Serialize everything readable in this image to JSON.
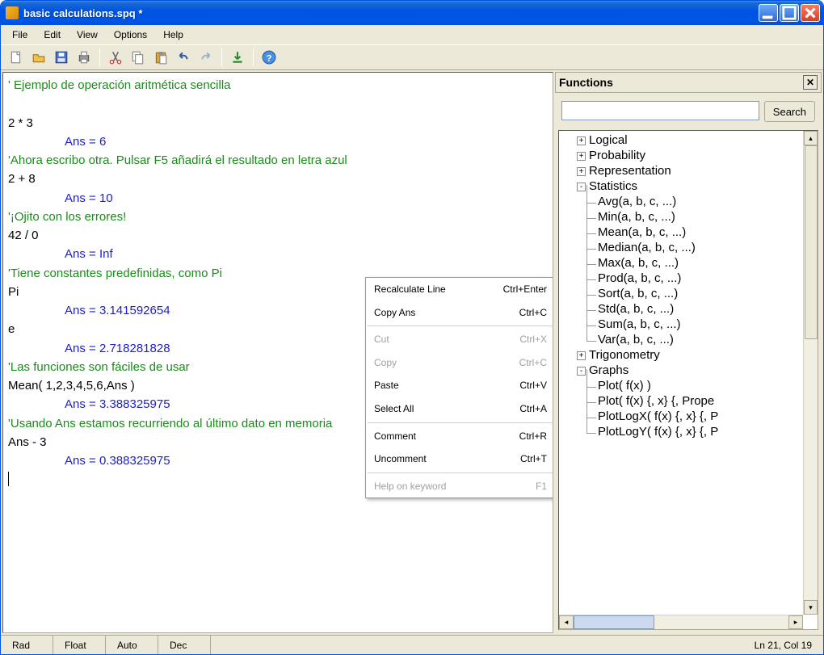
{
  "title": "basic calculations.spq *",
  "menubar": [
    "File",
    "Edit",
    "View",
    "Options",
    "Help"
  ],
  "toolbar_icons": [
    "new-icon",
    "open-icon",
    "save-icon",
    "print-icon",
    "|",
    "cut-icon",
    "copy-icon",
    "paste-icon",
    "undo-icon",
    "redo-icon",
    "|",
    "run-icon",
    "|",
    "help-icon"
  ],
  "editor": [
    {
      "t": "comment",
      "v": "' Ejemplo de operación aritmética sencilla"
    },
    {
      "t": "blank",
      "v": ""
    },
    {
      "t": "expr",
      "v": "2 * 3"
    },
    {
      "t": "ans",
      "v": "Ans = 6"
    },
    {
      "t": "comment",
      "v": "'Ahora escribo otra. Pulsar F5 añadirá el resultado en letra azul"
    },
    {
      "t": "expr",
      "v": "2 + 8"
    },
    {
      "t": "ans",
      "v": "Ans = 10"
    },
    {
      "t": "comment",
      "v": "'¡Ojito con los errores!"
    },
    {
      "t": "expr",
      "v": "42 / 0"
    },
    {
      "t": "ans",
      "v": "Ans = Inf"
    },
    {
      "t": "comment",
      "v": "'Tiene constantes predefinidas, como Pi"
    },
    {
      "t": "expr",
      "v": "Pi"
    },
    {
      "t": "ans",
      "v": "Ans = 3.141592654"
    },
    {
      "t": "expr",
      "v": "e"
    },
    {
      "t": "ans",
      "v": "Ans = 2.718281828"
    },
    {
      "t": "comment",
      "v": "'Las funciones son fáciles de usar"
    },
    {
      "t": "expr",
      "v": "Mean( 1,2,3,4,5,6,Ans )"
    },
    {
      "t": "ans",
      "v": "Ans = 3.388325975"
    },
    {
      "t": "comment",
      "v": "'Usando Ans estamos recurriendo al último dato en memoria"
    },
    {
      "t": "expr",
      "v": "Ans - 3"
    },
    {
      "t": "ans",
      "v": "Ans = 0.388325975"
    }
  ],
  "context_menu": [
    {
      "label": "Recalculate Line",
      "short": "Ctrl+Enter",
      "disabled": false
    },
    {
      "label": "Copy Ans",
      "short": "Ctrl+C",
      "disabled": false
    },
    {
      "divider": true
    },
    {
      "label": "Cut",
      "short": "Ctrl+X",
      "disabled": true
    },
    {
      "label": "Copy",
      "short": "Ctrl+C",
      "disabled": true
    },
    {
      "label": "Paste",
      "short": "Ctrl+V",
      "disabled": false
    },
    {
      "label": "Select All",
      "short": "Ctrl+A",
      "disabled": false
    },
    {
      "divider": true
    },
    {
      "label": "Comment",
      "short": "Ctrl+R",
      "disabled": false
    },
    {
      "label": "Uncomment",
      "short": "Ctrl+T",
      "disabled": false
    },
    {
      "divider": true
    },
    {
      "label": "Help on keyword",
      "short": "F1",
      "disabled": true
    }
  ],
  "sidepanel": {
    "title": "Functions",
    "search_button": "Search",
    "search_value": "",
    "tree": [
      {
        "t": "cat",
        "exp": "+",
        "label": "Logical"
      },
      {
        "t": "cat",
        "exp": "+",
        "label": "Probability"
      },
      {
        "t": "cat",
        "exp": "+",
        "label": "Representation"
      },
      {
        "t": "cat",
        "exp": "-",
        "label": "Statistics"
      },
      {
        "t": "leaf",
        "label": "Avg(a, b, c, ...)"
      },
      {
        "t": "leaf",
        "label": "Min(a, b, c, ...)"
      },
      {
        "t": "leaf",
        "label": "Mean(a, b, c, ...)"
      },
      {
        "t": "leaf",
        "label": "Median(a, b, c, ...)"
      },
      {
        "t": "leaf",
        "label": "Max(a, b, c, ...)"
      },
      {
        "t": "leaf",
        "label": "Prod(a, b, c, ...)"
      },
      {
        "t": "leaf",
        "label": "Sort(a, b, c, ...)"
      },
      {
        "t": "leaf",
        "label": "Std(a, b, c, ...)"
      },
      {
        "t": "leaf",
        "label": "Sum(a, b, c, ...)"
      },
      {
        "t": "leaf",
        "label": "Var(a, b, c, ...)"
      },
      {
        "t": "cat",
        "exp": "+",
        "label": "Trigonometry"
      },
      {
        "t": "cat",
        "exp": "-",
        "label": "Graphs"
      },
      {
        "t": "leaf",
        "label": "Plot( f(x) )"
      },
      {
        "t": "leaf",
        "label": "Plot( f(x) {, x} {, Prope"
      },
      {
        "t": "leaf",
        "label": "PlotLogX( f(x) {, x} {, P"
      },
      {
        "t": "leaf",
        "label": "PlotLogY( f(x) {, x} {, P"
      }
    ]
  },
  "status": {
    "angle": "Rad",
    "float": "Float",
    "auto": "Auto",
    "base": "Dec",
    "pos": "Ln 21, Col 19"
  }
}
